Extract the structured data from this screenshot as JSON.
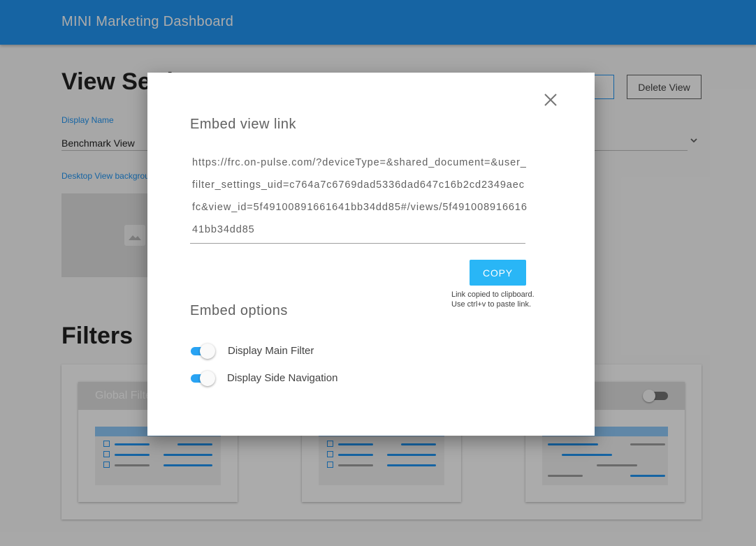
{
  "app": {
    "title": "MINI Marketing Dashboard"
  },
  "page": {
    "heading": "View Settings",
    "actions": {
      "delete_label": "Delete View"
    },
    "display_name": {
      "label": "Display Name",
      "value": "Benchmark View"
    },
    "desktop_background": {
      "label": "Desktop View background"
    },
    "filters_heading": "Filters",
    "filter_cards": [
      {
        "title": "Global Filters"
      }
    ]
  },
  "dialog": {
    "title": "Embed view link",
    "link": "https://frc.on-pulse.com/?deviceType=&shared_document=&user_filter_settings_uid=c764a7c6769dad5336dad647c16b2cd2349aecfc&view_id=5f49100891661641bb34dd85#/views/5f49100891661641bb34dd85",
    "copy_label": "COPY",
    "copy_message_line1": "Link copied to clipboard.",
    "copy_message_line2": "Use ctrl+v to paste link.",
    "options_title": "Embed options",
    "options": [
      {
        "label": "Display Main Filter",
        "enabled": true
      },
      {
        "label": "Display Side Navigation",
        "enabled": true
      }
    ]
  },
  "colors": {
    "app_bar": "#2196f3",
    "accent": "#29b6f6",
    "toggle_track": "#29a3f3"
  },
  "icons": {
    "close": "close-icon",
    "chevron": "chevron-down-icon",
    "image": "image-icon"
  }
}
